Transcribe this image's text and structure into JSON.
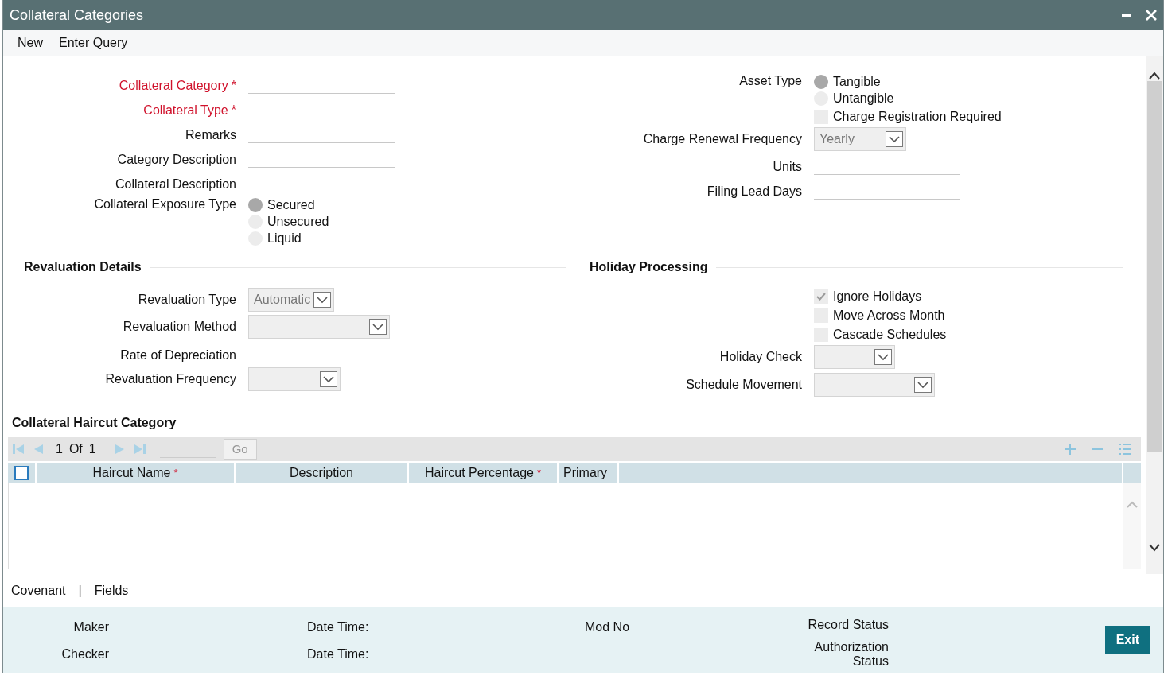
{
  "window": {
    "title": "Collateral Categories"
  },
  "menu": [
    {
      "label": "New"
    },
    {
      "label": "Enter Query"
    }
  ],
  "left_fields": [
    {
      "kind": "text",
      "label": "Collateral Category",
      "required_mark": "*"
    },
    {
      "kind": "text",
      "label": "Collateral Type",
      "required_mark": "*"
    },
    {
      "kind": "text",
      "label": "Remarks"
    },
    {
      "kind": "text",
      "label": "Category Description"
    },
    {
      "kind": "text",
      "label": "Collateral Description"
    },
    {
      "kind": "radio",
      "label": "Collateral Exposure Type",
      "options": [
        {
          "label": "Secured",
          "selected": true
        },
        {
          "label": "Unsecured",
          "selected": false
        },
        {
          "label": "Liquid",
          "selected": false
        }
      ]
    }
  ],
  "right_fields": [
    {
      "kind": "radio",
      "label": "Asset Type",
      "options": [
        {
          "label": "Tangible",
          "selected": true
        },
        {
          "label": "Untangible",
          "selected": false
        }
      ]
    },
    {
      "kind": "checkbox",
      "label": "Charge Registration Required",
      "checked": false
    },
    {
      "kind": "select",
      "label": "Charge Renewal Frequency",
      "value": "Yearly"
    },
    {
      "kind": "text",
      "label": "Units"
    },
    {
      "kind": "text",
      "label": "Filing Lead Days"
    }
  ],
  "sections": [
    {
      "title": "Revaluation Details",
      "fields": [
        {
          "kind": "select",
          "label": "Revaluation Type",
          "value": "Automatic"
        },
        {
          "kind": "select",
          "label": "Revaluation Method"
        },
        {
          "kind": "text",
          "label": "Rate of Depreciation"
        },
        {
          "kind": "select",
          "label": "Revaluation Frequency"
        }
      ]
    },
    {
      "title": "Holiday Processing",
      "fields": [
        {
          "kind": "checkbox",
          "label": "Ignore Holidays",
          "checked": true
        },
        {
          "kind": "checkbox",
          "label": "Move Across Month",
          "checked": false
        },
        {
          "kind": "checkbox",
          "label": "Cascade Schedules",
          "checked": false
        },
        {
          "kind": "select",
          "label": "Holiday Check"
        },
        {
          "kind": "select",
          "label": "Schedule Movement"
        }
      ]
    }
  ],
  "haircut": {
    "title": "Collateral Haircut Category",
    "pager": {
      "current": "1",
      "of": "Of",
      "total": "1",
      "go": "Go"
    },
    "select_all": {
      "checked": false
    },
    "columns": [
      {
        "label": "Haircut Name",
        "required_mark": "*"
      },
      {
        "label": "Description"
      },
      {
        "label": "Haircut Percentage",
        "required_mark": "*"
      },
      {
        "label": "Primary"
      }
    ]
  },
  "links": [
    {
      "label": "Covenant"
    },
    {
      "label": "Fields"
    }
  ],
  "link_separator": "|",
  "audit": [
    {
      "label": "Maker"
    },
    {
      "label": "Date Time:"
    },
    {
      "label": "Mod No"
    },
    {
      "label": "Record Status"
    },
    {
      "label": "Checker"
    },
    {
      "label": "Date Time:"
    },
    {
      "label": "Authorization Status"
    }
  ],
  "exit": {
    "label": "Exit"
  }
}
